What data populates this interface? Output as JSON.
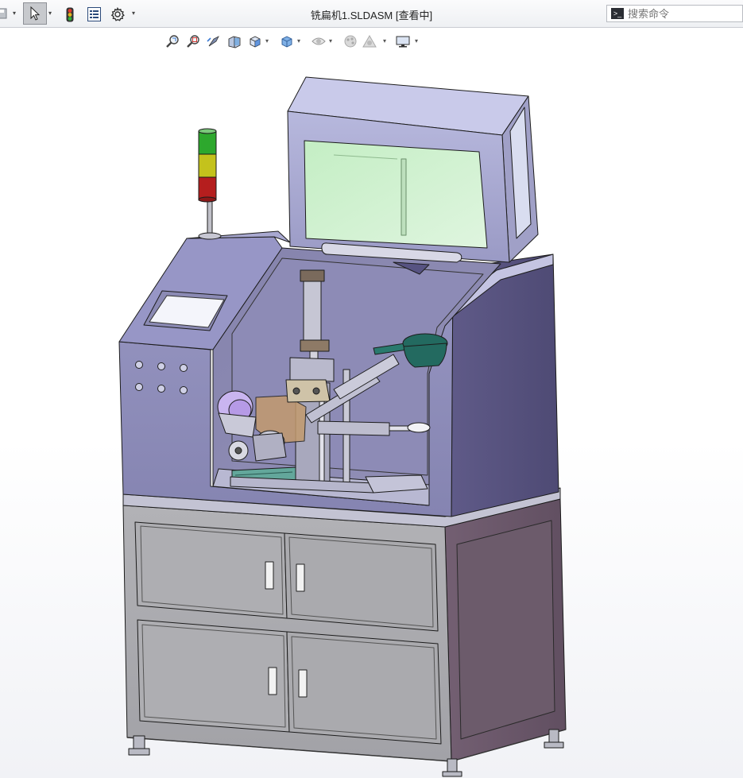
{
  "window": {
    "title": "铣扁机1.SLDASM [查看中]"
  },
  "toolbar": {
    "items": [
      {
        "name": "save-icon"
      },
      {
        "name": "select-pointer-icon"
      },
      {
        "name": "traffic-light-icon"
      },
      {
        "name": "file-properties-icon"
      },
      {
        "name": "options-gear-icon"
      }
    ]
  },
  "search": {
    "placeholder": "搜索命令"
  },
  "heads_up_toolbar": {
    "items": [
      "zoom-to-fit-icon",
      "zoom-to-area-icon",
      "previous-view-icon",
      "section-view-icon",
      "view-orientation-icon",
      "display-style-icon",
      "hide-show-items-icon",
      "edit-appearance-icon",
      "apply-scene-icon",
      "view-settings-icon"
    ]
  },
  "colors": {
    "machine_body": "#8a89b4",
    "machine_dark": "#56517c",
    "cabinet": "#a9a9ad",
    "cabinet_side": "#6f5c6e",
    "glass": "#d2f0d2",
    "signal_green": "#2da82d",
    "signal_yellow": "#c4c21c",
    "signal_red": "#b51e1e"
  }
}
